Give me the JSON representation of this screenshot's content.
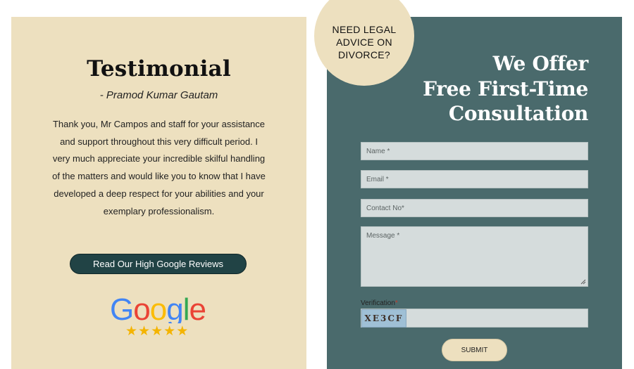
{
  "testimonial": {
    "title": "Testimonial",
    "author": "- Pramod Kumar Gautam",
    "body": "Thank you, Mr Campos and staff for your assistance and support throughout this very difficult period. I very much appreciate your incredible skilful handling of the matters and would like you to know that I have developed a deep respect for your abilities and your exemplary professionalism.",
    "button_label": "Read Our High Google Reviews",
    "google_logo_text": "Google",
    "rating": {
      "stars": 5,
      "max": 5
    }
  },
  "badge": {
    "line1": "NEED LEGAL",
    "line2": "ADVICE ON",
    "line3": "DIVORCE?"
  },
  "offer": {
    "line1": "We Offer",
    "line2": "Free First-Time",
    "line3": "Consultation"
  },
  "form": {
    "name_placeholder": "Name *",
    "email_placeholder": "Email *",
    "contact_placeholder": "Contact No*",
    "message_placeholder": "Message *",
    "verification_label": "Verification",
    "required_marker": "*",
    "captcha_text": "XE3CF",
    "submit_label": "SUBMIT"
  },
  "colors": {
    "cream": "#ede0bf",
    "teal_panel": "#4a6a6c",
    "button_dark": "#214345",
    "star": "#f4b400"
  }
}
